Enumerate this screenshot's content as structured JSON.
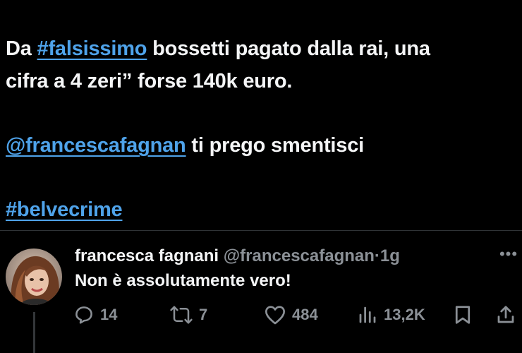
{
  "tweet": {
    "line1_prefix": "Da ",
    "line1_hashtag": "#falsissimo",
    "line1_suffix": " bossetti pagato dalla rai, una",
    "line2": "cifra a 4 zeri” forse 140k euro.",
    "mention": "@francescafagnan",
    "mention_suffix": " ti prego smentisci",
    "hashtag2": "#belvecrime"
  },
  "reply": {
    "name": "francesca fagnani",
    "handle": "@francescafagnan",
    "separator": "·",
    "time": "1g",
    "text": "Non è assolutamente vero!",
    "more_label": "•••",
    "actions": {
      "replies": "14",
      "reposts": "7",
      "likes": "484",
      "views": "13,2K"
    }
  },
  "icons": {
    "reply": "comment-icon",
    "repost": "repost-icon",
    "like": "heart-icon",
    "views": "views-icon",
    "bookmark": "bookmark-icon",
    "share": "share-icon"
  },
  "colors": {
    "background": "#000000",
    "text": "#f4f5f6",
    "link": "#4fa3ea",
    "muted": "#8b9096",
    "divider": "#2f3336"
  }
}
